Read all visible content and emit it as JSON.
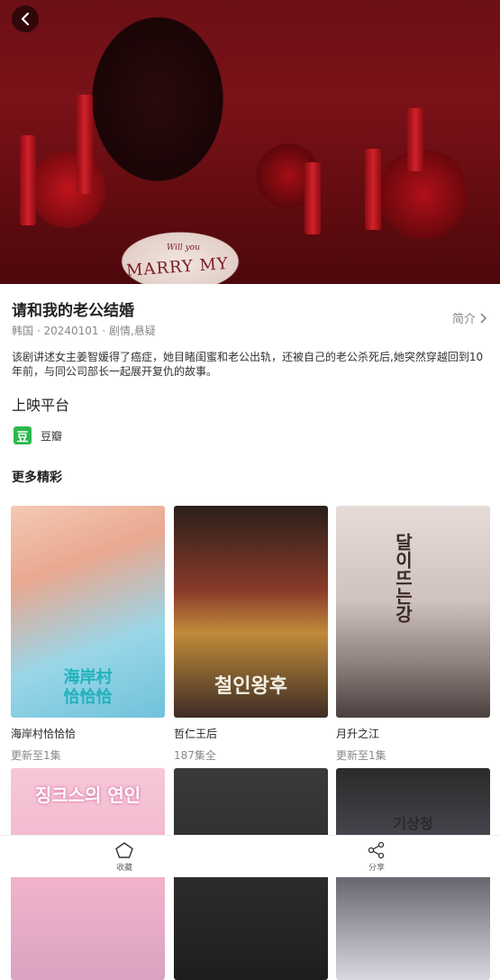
{
  "hero": {
    "cake_line1": "Will you",
    "cake_line2": "MARRY MY"
  },
  "drama": {
    "title": "请和我的老公结婚",
    "meta": "韩国 · 20240101 · 剧情,悬疑",
    "intro_label": "简介",
    "description": "该剧讲述女主姜智媛得了癌症，她目睹闺蜜和老公出轨，还被自己的老公杀死后,她突然穿越回到10年前，与同公司部长一起展开复仇的故事。"
  },
  "platforms": {
    "section_title": "上映平台",
    "items": [
      {
        "icon_char": "豆",
        "name": "豆瓣",
        "color": "#2db84d"
      }
    ]
  },
  "more": {
    "section_title": "更多精彩",
    "cards": [
      {
        "title": "海岸村恰恰恰",
        "sub": "更新至1集",
        "poster_text": "海岸村\n恰恰恰"
      },
      {
        "title": "哲仁王后",
        "sub": "187集全",
        "poster_text": "철인왕후"
      },
      {
        "title": "月升之江",
        "sub": "更新至1集",
        "poster_text": "달이뜨는강"
      },
      {
        "title": "",
        "sub": "",
        "poster_text": "징크스의 연인"
      },
      {
        "title": "",
        "sub": "",
        "poster_text": ""
      },
      {
        "title": "",
        "sub": "",
        "poster_text": "기상청"
      }
    ]
  },
  "bottom": {
    "favorite_label": "收藏",
    "share_label": "分享"
  }
}
